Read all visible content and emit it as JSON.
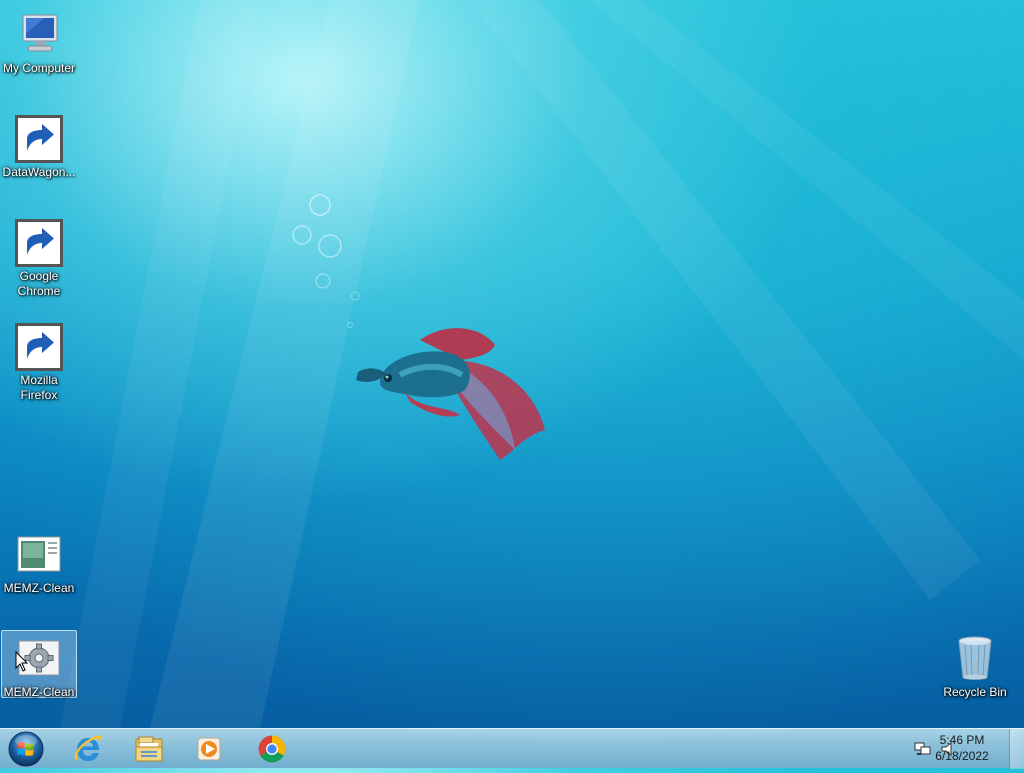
{
  "desktop": {
    "icons": [
      {
        "label": "My Computer",
        "icon": "computer-icon"
      },
      {
        "label": "DataWagon...",
        "icon": "datawagon-icon"
      },
      {
        "label": "Google Chrome",
        "icon": "chrome-icon"
      },
      {
        "label": "Mozilla Firefox",
        "icon": "firefox-icon"
      },
      {
        "label": "MEMZ-Clean",
        "icon": "memz-image-icon"
      },
      {
        "label": "MEMZ-Clean",
        "icon": "memz-settings-icon"
      },
      {
        "label": "Recycle Bin",
        "icon": "recycle-bin-icon"
      }
    ]
  },
  "taskbar": {
    "start_icon": "windows-start-icon",
    "pinned": [
      {
        "name": "Internet Explorer",
        "icon": "internet-explorer-icon"
      },
      {
        "name": "Windows Explorer",
        "icon": "file-explorer-icon"
      },
      {
        "name": "Windows Media Player",
        "icon": "media-player-icon"
      },
      {
        "name": "Google Chrome",
        "icon": "chrome-icon"
      }
    ],
    "tray": {
      "network_icon": "network-icon",
      "volume_icon": "volume-icon",
      "time": "5:46 PM",
      "date": "6/18/2022"
    }
  },
  "colors": {
    "desktop_top": "#24c0da",
    "desktop_bottom": "#055a9c",
    "taskbar": "#9cc8de",
    "label_text": "#ffffff"
  }
}
